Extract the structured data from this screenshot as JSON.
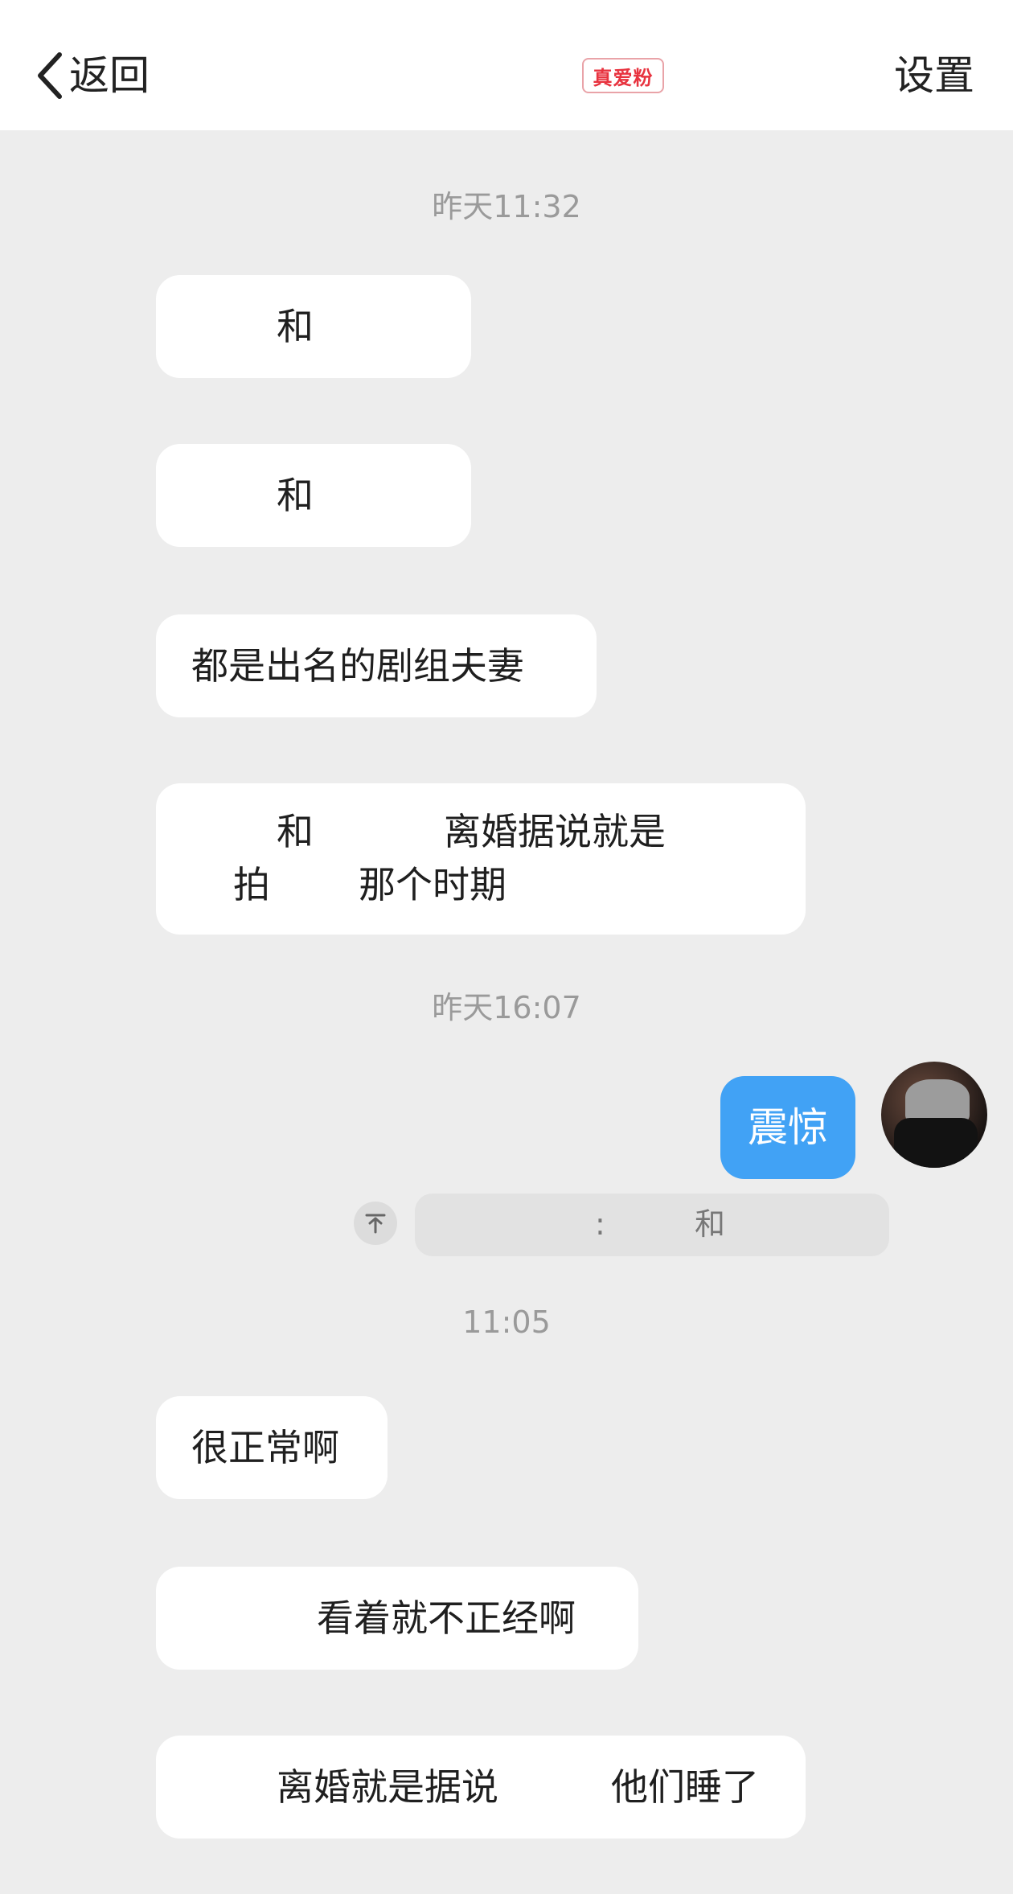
{
  "header": {
    "back_label": "返回",
    "badge": "真爱粉",
    "settings_label": "设置"
  },
  "timestamps": [
    "昨天11:32",
    "昨天16:07",
    "11:05"
  ],
  "messages_group1": {
    "m1": "和",
    "m2": "和",
    "m3": "都是出名的剧组夫妻",
    "m4_line1_a": "和",
    "m4_line1_b": "离婚据说就是",
    "m4_line2_a": "拍",
    "m4_line2_b": "那个时期"
  },
  "my_message": {
    "text": "震惊"
  },
  "quote": {
    "colon": ":",
    "text": "和"
  },
  "messages_group3": {
    "m1": "很正常啊",
    "m2": "看着就不正经啊",
    "m3_a": "离婚就是据说",
    "m3_b": "他们睡了"
  },
  "colors": {
    "background": "#ededed",
    "my_bubble": "#41a2f5",
    "badge": "#e8333f"
  },
  "icons": [
    "chevron-left-icon",
    "quote-arrow-icon"
  ]
}
